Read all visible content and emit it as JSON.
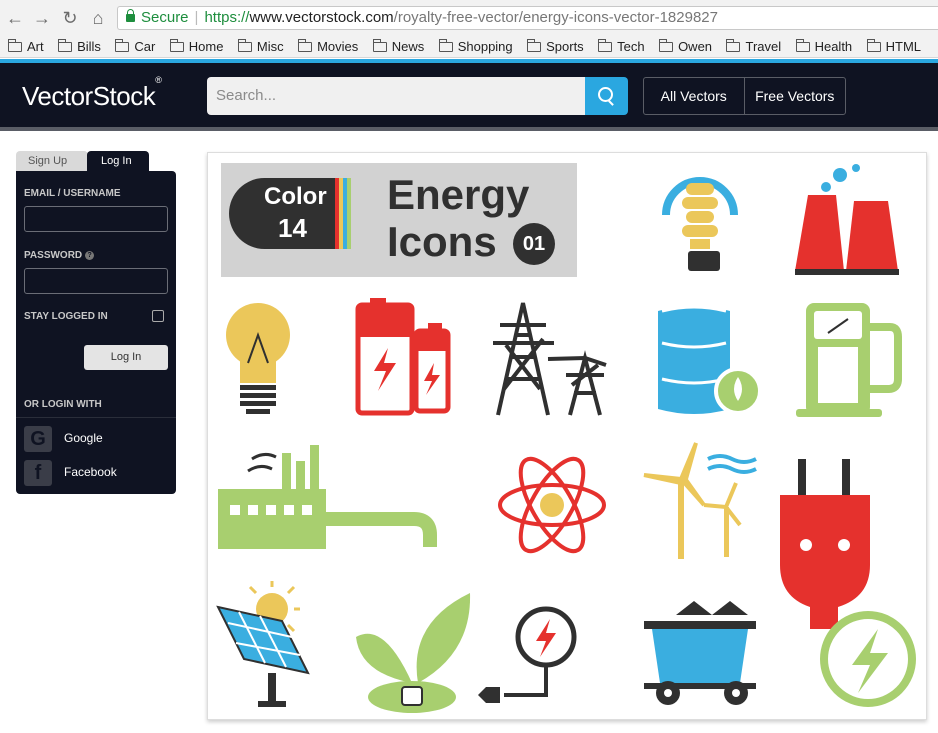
{
  "browser": {
    "secure_label": "Secure",
    "url_scheme": "https://",
    "url_host": "www.vectorstock.com",
    "url_path": "/royalty-free-vector/energy-icons-vector-1829827",
    "bookmarks": [
      "Art",
      "Bills",
      "Car",
      "Home",
      "Misc",
      "Movies",
      "News",
      "Shopping",
      "Sports",
      "Tech",
      "Owen",
      "Travel",
      "Health",
      "HTML"
    ]
  },
  "header": {
    "logo": "VectorStock",
    "logo_mark": "®",
    "search_placeholder": "Search...",
    "nav": [
      "All Vectors",
      "Free Vectors"
    ],
    "colors": {
      "bg": "#0f1322",
      "accent": "#2aa7e0"
    }
  },
  "login": {
    "tab_signup": "Sign Up",
    "tab_login": "Log In",
    "email_label": "EMAIL / USERNAME",
    "password_label": "PASSWORD",
    "help_mark": "?",
    "stay_logged_in": "STAY LOGGED IN",
    "login_button": "Log In",
    "or_login_with": "OR LOGIN WITH",
    "google": "Google",
    "google_mark": "G",
    "facebook": "Facebook",
    "facebook_mark": "f"
  },
  "preview": {
    "badge_word": "Color",
    "badge_num": "14",
    "title_line1": "Energy",
    "title_line2": "Icons",
    "number": "01",
    "colors": {
      "yellow": "#ebc75a",
      "red": "#e5312d",
      "blue": "#3aaee0",
      "green": "#a8cf6f",
      "dark": "#303030"
    },
    "icons": [
      "light-bulb-cfl",
      "power-plant",
      "light-bulb",
      "batteries",
      "power-towers",
      "oil-barrel",
      "fuel-pump",
      "factory-pipeline",
      "atom",
      "wind-turbines",
      "electric-plug",
      "solar-panel",
      "plant-socket",
      "charging-cable",
      "coal-cart",
      "energy-bolt"
    ]
  }
}
